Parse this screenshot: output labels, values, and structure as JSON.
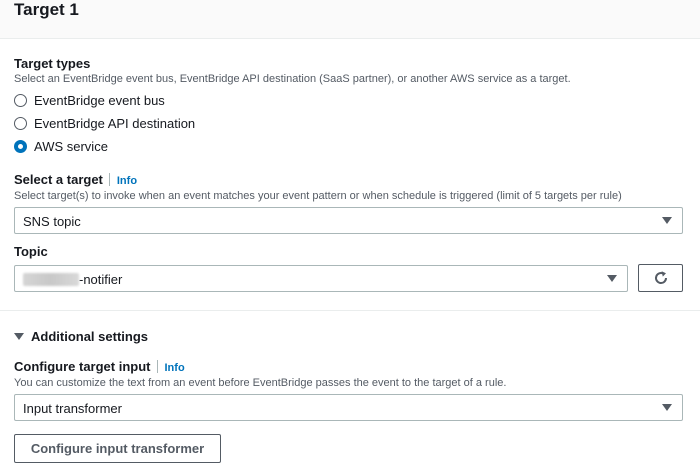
{
  "header": {
    "title": "Target 1"
  },
  "target_types": {
    "label": "Target types",
    "description": "Select an EventBridge event bus, EventBridge API destination (SaaS partner), or another AWS service as a target.",
    "options": [
      {
        "label": "EventBridge event bus",
        "checked": false
      },
      {
        "label": "EventBridge API destination",
        "checked": false
      },
      {
        "label": "AWS service",
        "checked": true
      }
    ]
  },
  "select_target": {
    "label": "Select a target",
    "info": "Info",
    "description": "Select target(s) to invoke when an event matches your event pattern or when schedule is triggered (limit of 5 targets per rule)",
    "value": "SNS topic"
  },
  "topic": {
    "label": "Topic",
    "value_suffix": "-notifier",
    "refresh_icon": "refresh-icon"
  },
  "additional_settings": {
    "label": "Additional settings",
    "expanded": true
  },
  "configure_input": {
    "label": "Configure target input",
    "info": "Info",
    "description": "You can customize the text from an event before EventBridge passes the event to the target of a rule.",
    "value": "Input transformer"
  },
  "configure_button": {
    "label": "Configure input transformer"
  },
  "colors": {
    "accent": "#0073bb",
    "text": "#16191f",
    "muted": "#545b64",
    "border": "#aab7b8"
  }
}
